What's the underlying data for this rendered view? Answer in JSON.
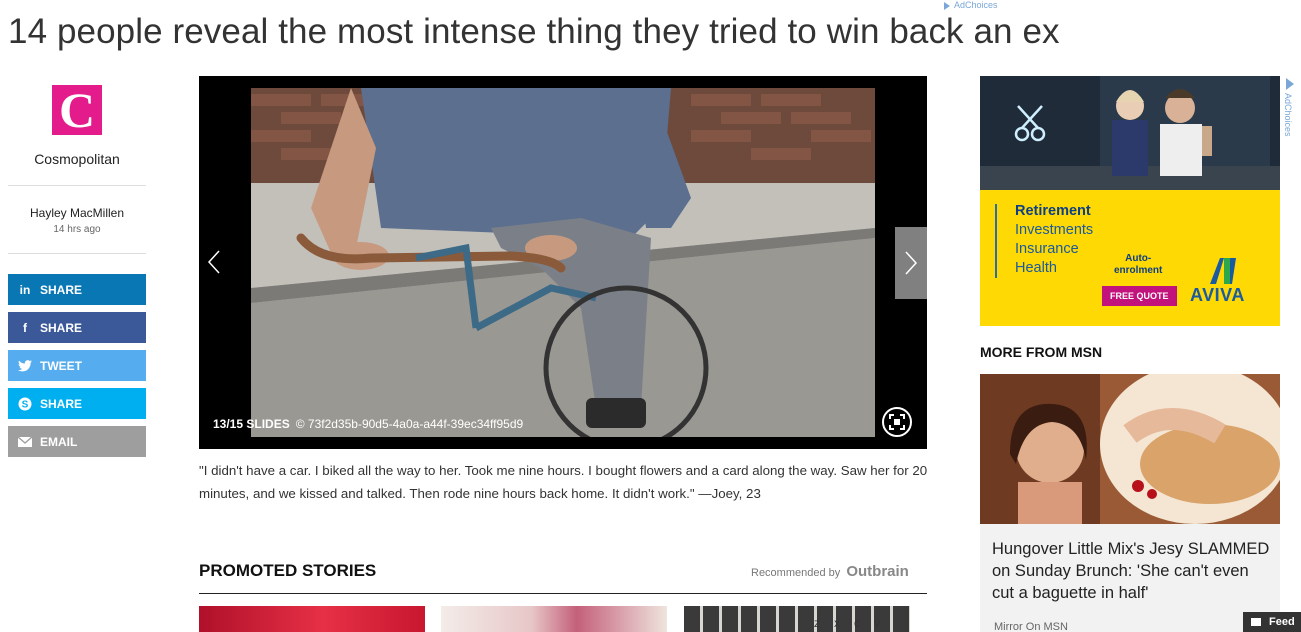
{
  "top_adchoices": "AdChoices",
  "headline": "14 people reveal the most intense thing they tried to win back an ex",
  "publisher": {
    "logo_letter": "C",
    "name": "Cosmopolitan",
    "brand_color": "#e31b8b"
  },
  "author": {
    "name": "Hayley MacMillen",
    "time": "14 hrs ago"
  },
  "share_buttons": [
    {
      "network": "linkedin",
      "label": "SHARE",
      "icon": "linkedin-icon",
      "glyph": "in",
      "color": "#0a77b5"
    },
    {
      "network": "facebook",
      "label": "SHARE",
      "icon": "facebook-icon",
      "glyph": "f",
      "color": "#3b5998"
    },
    {
      "network": "twitter",
      "label": "TWEET",
      "icon": "twitter-icon",
      "glyph": "🐦",
      "color": "#55acee"
    },
    {
      "network": "skype",
      "label": "SHARE",
      "icon": "skype-icon",
      "glyph": "S",
      "color": "#00aff0"
    },
    {
      "network": "email",
      "label": "EMAIL",
      "icon": "email-icon",
      "glyph": "✉",
      "color": "#9e9e9e"
    }
  ],
  "slideshow": {
    "counter": "13/15 SLIDES",
    "credit": "© 73f2d35b-90d5-4a0a-a44f-39ec34ff95d9"
  },
  "caption": "\"I didn't have a car. I biked all the way to her. Took me nine hours. I bought flowers and a card along the way. Saw her for 20 minutes, and we kissed and talked. Then rode nine hours back home. It didn't work.\" —Joey, 23",
  "promoted": {
    "title": "PROMOTED STORIES",
    "recommended_by": "Recommended by",
    "brand": "Outbrain",
    "thumb3_keys": "ZXCV"
  },
  "side_ad": {
    "adchoices": "AdChoices",
    "products": [
      "Retirement",
      "Investments",
      "Insurance",
      "Health"
    ],
    "auto_enrolment": "Auto-\nenrolment",
    "cta": "FREE QUOTE",
    "brand": "AVIVA"
  },
  "more_from_msn": {
    "title": "MORE FROM MSN",
    "headline": "Hungover Little Mix's Jesy SLAMMED on Sunday Brunch: 'She can't even cut a baguette in half'",
    "source": "Mirror On MSN"
  },
  "feedback_label": "Feed"
}
